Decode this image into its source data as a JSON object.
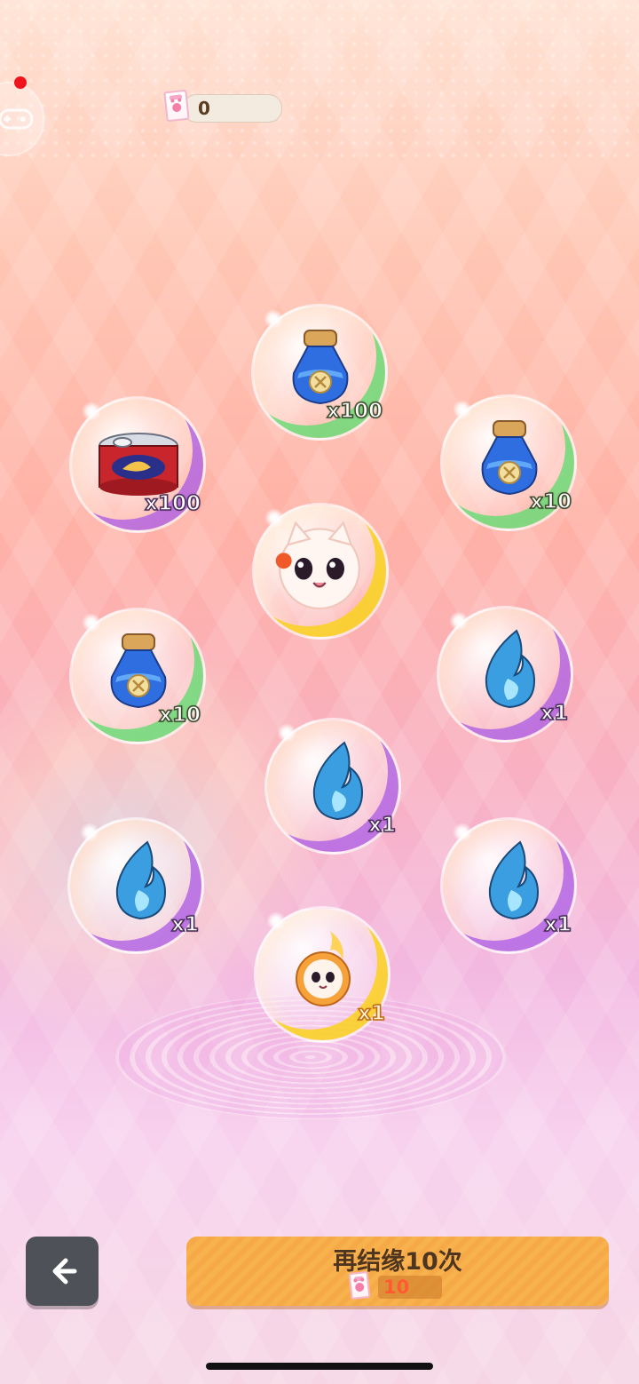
{
  "header": {
    "currency_value": "0",
    "currency_icon": "paw-ticket-icon",
    "notification_dot_color": "#f0141c"
  },
  "rewards": [
    {
      "item": "blue-potion-bottle-icon",
      "quantity": "x100",
      "bubble_color": "green"
    },
    {
      "item": "fish-can-icon",
      "quantity": "x100",
      "bubble_color": "purple"
    },
    {
      "item": "blue-potion-bottle-icon",
      "quantity": "x10",
      "bubble_color": "green"
    },
    {
      "item": "cat-character-portrait",
      "quantity": "",
      "bubble_color": "gold"
    },
    {
      "item": "blue-potion-bottle-icon",
      "quantity": "x10",
      "bubble_color": "green"
    },
    {
      "item": "blue-flame-icon",
      "quantity": "x1",
      "bubble_color": "purple"
    },
    {
      "item": "blue-flame-icon",
      "quantity": "x1",
      "bubble_color": "purple"
    },
    {
      "item": "blue-flame-icon",
      "quantity": "x1",
      "bubble_color": "purple"
    },
    {
      "item": "blue-flame-icon",
      "quantity": "x1",
      "bubble_color": "purple"
    },
    {
      "item": "fire-cat-avatar-icon",
      "quantity": "x1",
      "bubble_color": "gold"
    }
  ],
  "footer": {
    "back_icon": "chevron-left-icon",
    "draw_again_label": "再结缘10次",
    "draw_cost": "10",
    "draw_cost_icon": "paw-ticket-icon",
    "button_color": "#f8b24d"
  }
}
